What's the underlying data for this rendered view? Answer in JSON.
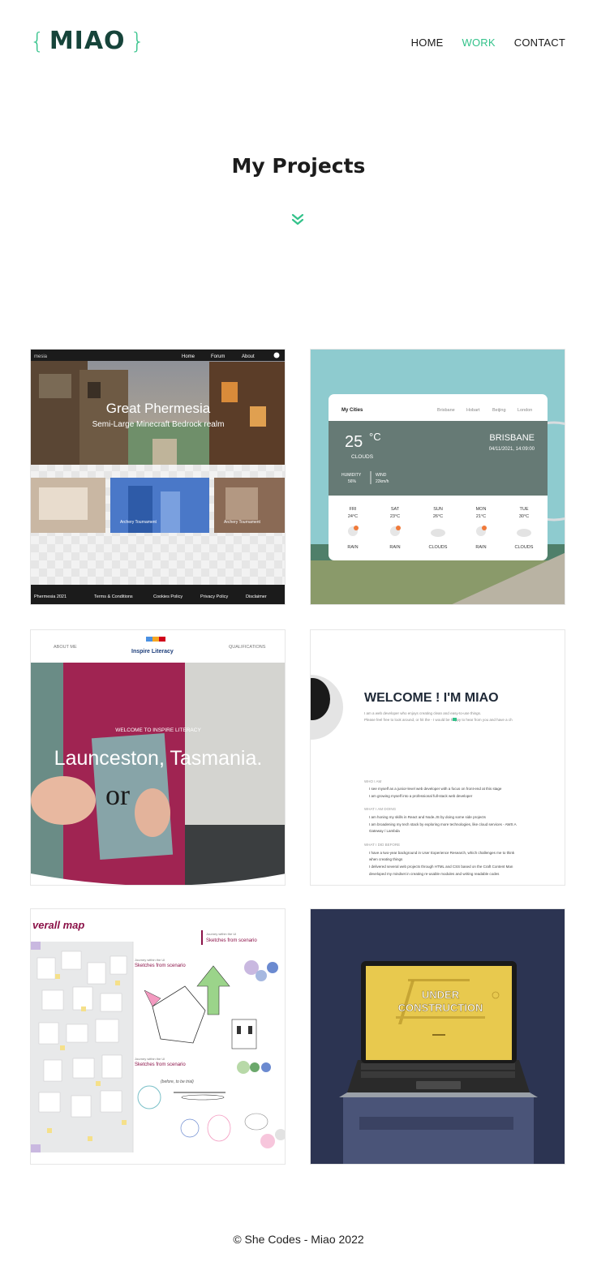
{
  "header": {
    "logo": {
      "open_brace": "{",
      "word": "MIAO",
      "close_brace": "}"
    },
    "nav": [
      {
        "label": "HOME",
        "active": false
      },
      {
        "label": "WORK",
        "active": true
      },
      {
        "label": "CONTACT",
        "active": false
      }
    ]
  },
  "page": {
    "title": "My Projects",
    "scroll_icon": "double-chevron-down-icon"
  },
  "projects": {
    "minecraft": {
      "nav": [
        "Home",
        "Forum",
        "About"
      ],
      "hero_title": "Great Phermesia",
      "hero_subtitle": "Semi-Large Minecraft Bedrock realm",
      "thumb_labels": [
        "Archery Tournament",
        "Archery Tournament"
      ],
      "footer_links": [
        "Phermesia 2021",
        "Terms & Conditions",
        "Cookies Policy",
        "Privacy Policy",
        "Disclaimer"
      ]
    },
    "weather": {
      "app_title": "My Cities",
      "cities": [
        "Brisbane",
        "Hobart",
        "Beijing",
        "London"
      ],
      "temperature": "25",
      "unit": "°C",
      "condition": "CLOUDS",
      "city": "BRISBANE",
      "datetime": "04/11/2021, 14:09:00",
      "humidity_label": "HUMIDITY",
      "humidity_value": "56%",
      "wind_label": "WIND",
      "wind_value": "22km/h",
      "forecast": [
        {
          "day": "FRI",
          "temp": "24°C",
          "cond": "RAIN"
        },
        {
          "day": "SAT",
          "temp": "23°C",
          "cond": "RAIN"
        },
        {
          "day": "SUN",
          "temp": "26°C",
          "cond": "CLOUDS"
        },
        {
          "day": "MON",
          "temp": "21°C",
          "cond": "RAIN"
        },
        {
          "day": "TUE",
          "temp": "30°C",
          "cond": "CLOUDS"
        }
      ]
    },
    "literacy": {
      "nav_left": "ABOUT ME",
      "brand": "Inspire Literacy",
      "nav_right": "QUALIFICATIONS",
      "welcome": "WELCOME TO INSPIRE LITERACY",
      "headline": "Launceston, Tasmania.",
      "book_text": "or"
    },
    "portfolio": {
      "headline": "WELCOME ! I'M MIAO",
      "intro_1": "I am a web developer who enjoys creating clean and easy-to-use things.",
      "intro_2": "Please feel free to look around, or hit the  - I would be happy to hear from you and have a ch",
      "section_1": "WHO I AM",
      "who_1": "I see myself as a junior-level web developer with a focus on front-end at this stage",
      "who_2": "I am growing myself into a professional full-stack web developer",
      "section_2": "WHAT I AM DOING",
      "doing_1": "I am honing my skills in React and Node.JS by doing some side projects",
      "doing_2": "I am broadening my tech stack by exploring more technologies, like cloud services - AWS A",
      "doing_3": "Gateway / Lambda",
      "section_3": "WHAT I DID BEFORE",
      "before_1": "I have a two-year background in User Experience Research, which challenges me to think",
      "before_2": "when creating things",
      "before_3": "I delivered several web projects through HTML and CSS based on the Craft Content Man",
      "before_4": "developed my mindset in creating re-usable modules and writing readable codes"
    },
    "sketch": {
      "heading": "verall map",
      "label_top_small": "Journey within the UI",
      "label_top": "Sketches from scenario",
      "label_mid_small": "Journey within the UI",
      "label_mid": "Sketches from scenario",
      "label_bot_small": "Journey within the UI",
      "label_bot": "Sketches from scenario",
      "note": "(before, to be trial)"
    },
    "construction": {
      "line_1": "UNDER",
      "line_2": "CONSTRUCTION"
    }
  },
  "footer": {
    "text": "© She Codes - Miao 2022"
  },
  "colors": {
    "accent": "#33c28a",
    "logo_text": "#16443a",
    "highlight": "#c8f0dd"
  }
}
